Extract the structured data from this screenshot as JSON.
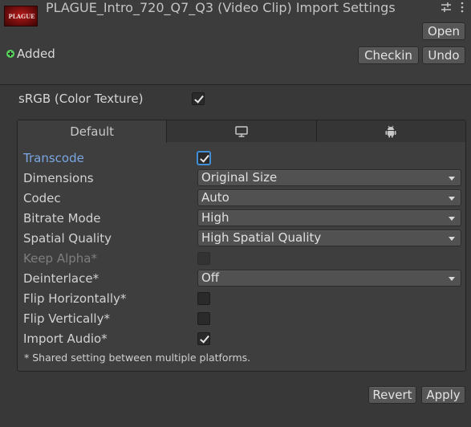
{
  "header": {
    "title": "PLAGUE_Intro_720_Q7_Q3 (Video Clip) Import Settings",
    "thumbnail_text": "PLAGUE",
    "open_label": "Open",
    "checkin_label": "Checkin",
    "undo_label": "Undo",
    "status_text": "Added"
  },
  "srgb": {
    "label": "sRGB (Color Texture)",
    "checked": true
  },
  "tabs": [
    {
      "label": "Default",
      "icon": ""
    },
    {
      "label": "",
      "icon": "monitor-icon"
    },
    {
      "label": "",
      "icon": "android-icon"
    }
  ],
  "settings": {
    "transcode": {
      "label": "Transcode",
      "checked": true
    },
    "dimensions": {
      "label": "Dimensions",
      "value": "Original Size"
    },
    "codec": {
      "label": "Codec",
      "value": "Auto"
    },
    "bitrate_mode": {
      "label": "Bitrate Mode",
      "value": "High"
    },
    "spatial_quality": {
      "label": "Spatial Quality",
      "value": "High Spatial Quality"
    },
    "keep_alpha": {
      "label": "Keep Alpha*",
      "checked": false,
      "disabled": true
    },
    "deinterlace": {
      "label": "Deinterlace*",
      "value": "Off"
    },
    "flip_horizontally": {
      "label": "Flip Horizontally*",
      "checked": false
    },
    "flip_vertically": {
      "label": "Flip Vertically*",
      "checked": false
    },
    "import_audio": {
      "label": "Import Audio*",
      "checked": true
    }
  },
  "footnote": "* Shared setting between multiple platforms.",
  "footer": {
    "revert_label": "Revert",
    "apply_label": "Apply"
  },
  "colors": {
    "background": "#383838",
    "panel": "#3e3e3e",
    "accent_blue": "#7aa6e2",
    "added_green": "#55d35a"
  }
}
